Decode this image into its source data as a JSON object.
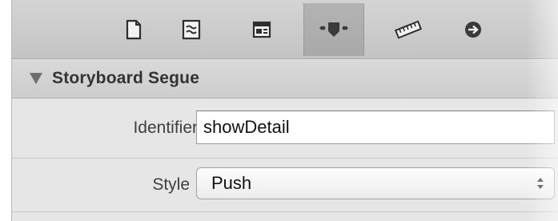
{
  "toolbar": {
    "tabs": [
      {
        "icon": "file-inspector-icon",
        "selected": false
      },
      {
        "icon": "quick-help-icon",
        "selected": false
      },
      {
        "icon": "identity-inspector-icon",
        "selected": false
      },
      {
        "icon": "attributes-inspector-icon",
        "selected": true
      },
      {
        "icon": "size-inspector-icon",
        "selected": false
      },
      {
        "icon": "connections-inspector-icon",
        "selected": false
      }
    ]
  },
  "section": {
    "title": "Storyboard Segue",
    "expanded": true
  },
  "identifier": {
    "label": "Identifier",
    "value": "showDetail"
  },
  "style": {
    "label": "Style",
    "value": "Push"
  }
}
